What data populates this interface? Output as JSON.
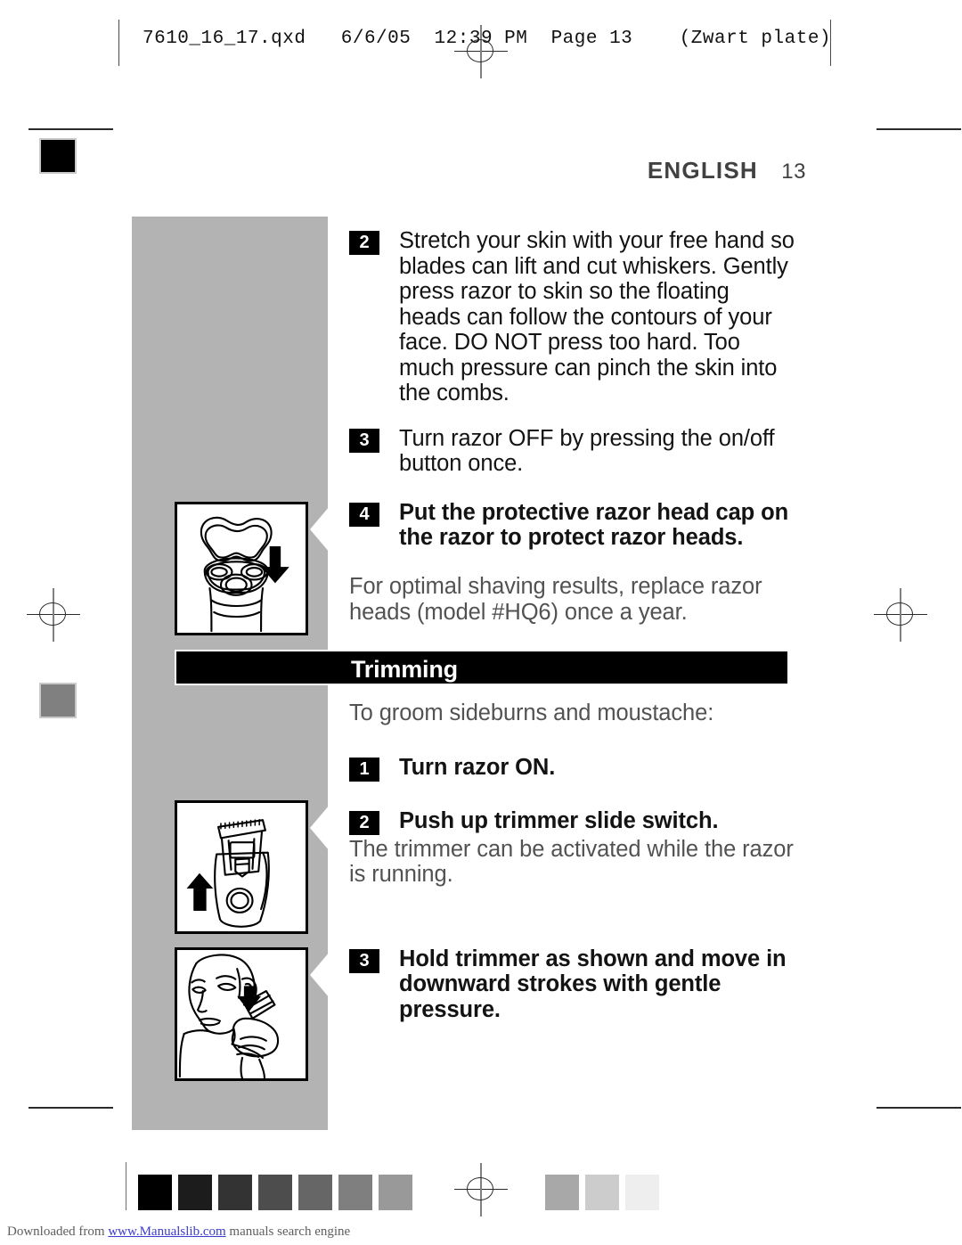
{
  "prepress": {
    "header_text": "7610_16_17.qxd   6/6/05  12:39 PM  Page 13    (Zwart plate)",
    "registration_icon": "registration-crosshair-icon",
    "margin_swatch_black": "#000000",
    "margin_swatch_gray": "#808080"
  },
  "page": {
    "language": "ENGLISH",
    "folio": "13"
  },
  "instructions": {
    "steps": [
      {
        "number": "2",
        "text": "Stretch your skin with your free hand so blades can lift and cut whiskers. Gently press razor to skin so the floating heads can follow the contours of your face. DO NOT press too hard. Too much pressure can pinch the skin into the combs.",
        "bold": false
      },
      {
        "number": "3",
        "text": "Turn razor OFF by pressing the on/off button once.",
        "bold": false
      },
      {
        "number": "4",
        "text": "Put the protective razor head cap on the razor to protect razor heads.",
        "bold": true
      }
    ],
    "note": "For optimal shaving results, replace razor heads (model #HQ6) once a year."
  },
  "trimming": {
    "banner_title": "Trimming",
    "intro": "To groom sideburns and moustache:",
    "steps": [
      {
        "number": "1",
        "text": "Turn razor ON.",
        "bold": true
      },
      {
        "number": "2",
        "text": "Push up trimmer slide switch.",
        "bold": true
      }
    ],
    "note": "The trimmer can be activated while the razor is running.",
    "step3": {
      "number": "3",
      "text": "Hold trimmer as shown and move in downward strokes with gentle pressure.",
      "bold": true
    }
  },
  "illustrations": [
    {
      "name": "razor-head-cap-illustration",
      "caption_arrow": "down-arrow"
    },
    {
      "name": "trimmer-slide-switch-illustration",
      "caption_arrow": "up-arrow"
    },
    {
      "name": "trimming-sideburn-illustration",
      "caption_arrow": "down-arrow"
    }
  ],
  "calibration_strip": {
    "swatches_left": [
      "#000000",
      "#1c1c1c",
      "#333333",
      "#4d4d4d",
      "#666666",
      "#7f7f7f",
      "#999999"
    ],
    "swatches_right": [
      "#a8a8a8",
      "#cccccc",
      "#eeeeee"
    ]
  },
  "footer": {
    "prefix": "Downloaded from ",
    "link": "www.Manualslib.com",
    "suffix": " manuals search engine"
  }
}
